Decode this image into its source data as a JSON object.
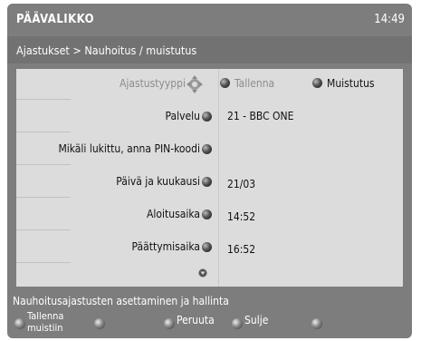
{
  "header": {
    "title": "PÄÄVALIKKO",
    "clock": "14:49"
  },
  "breadcrumb": "Ajastukset > Nauhoitus / muistutus",
  "form": {
    "type_label": "Ajastustyyppi",
    "type_options": [
      "Tallenna",
      "Muistutus"
    ],
    "service_label": "Palvelu",
    "service_value": "21 - BBC ONE",
    "pin_label": "Mikäli lukittu, anna PIN-koodi",
    "date_label": "Päivä ja kuukausi",
    "date_value": "21/03",
    "start_label": "Aloitusaika",
    "start_value": "14:52",
    "end_label": "Päättymisaika",
    "end_value": "16:52"
  },
  "footer": {
    "help_text": "Nauhoitusajastusten asettaminen ja hallinta",
    "buttons": {
      "save_line1": "Tallenna",
      "save_line2": "muistiin",
      "cancel": "Peruuta",
      "close": "Sulje"
    }
  },
  "colors": {
    "background": "#7d7d7d",
    "panel": "#dcdcdc",
    "text_dim": "#8c8c8c"
  }
}
